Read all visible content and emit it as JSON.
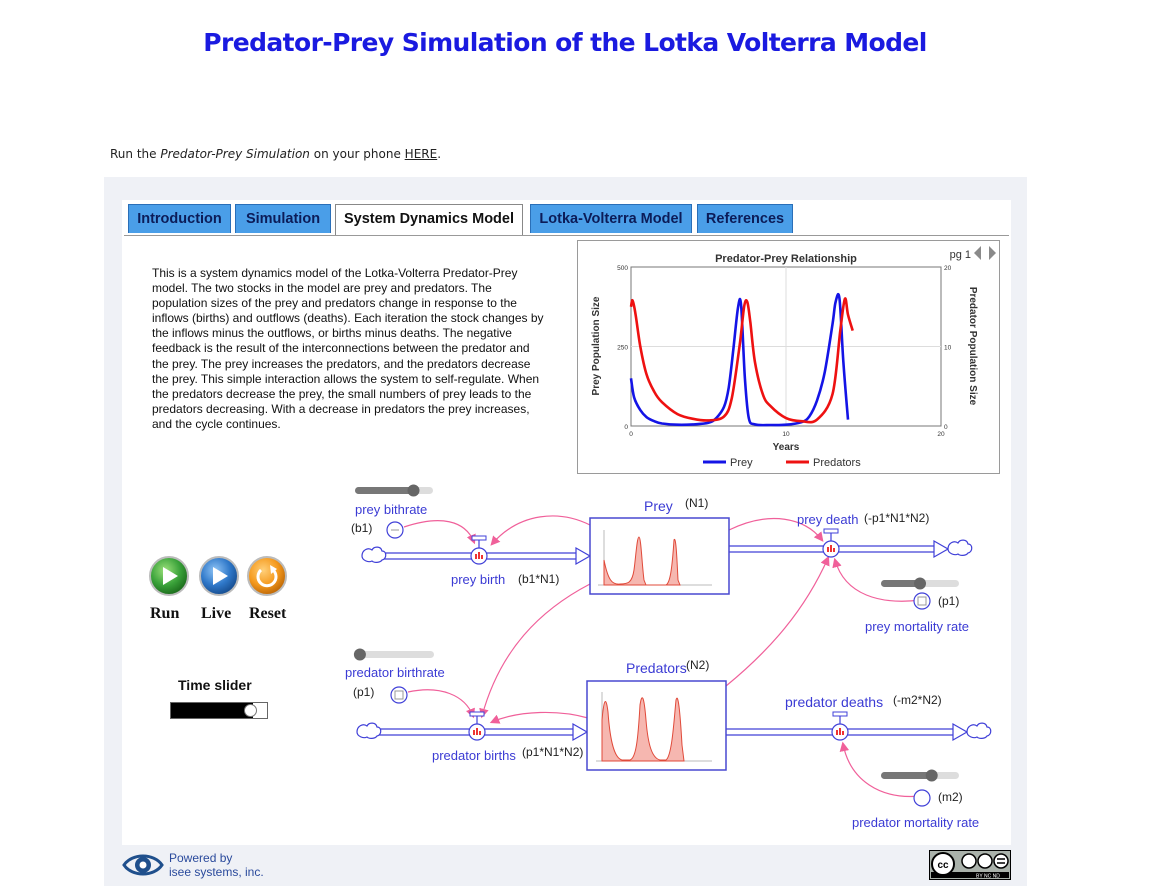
{
  "title": "Predator-Prey Simulation of the Lotka Volterra Model",
  "run_line": {
    "prefix": "Run the ",
    "italic": "Predator-Prey Simulation",
    "middle": " on your phone ",
    "link": "HERE",
    "suffix": "."
  },
  "tabs": [
    {
      "label": "Introduction",
      "active": false
    },
    {
      "label": "Simulation",
      "active": false
    },
    {
      "label": "System Dynamics Model",
      "active": true
    },
    {
      "label": "Lotka-Volterra Model",
      "active": false
    },
    {
      "label": "References",
      "active": false
    }
  ],
  "description": "This is a system dynamics model of the Lotka-Volterra Predator-Prey model. The two stocks in the model are prey and predators. The population sizes of the prey and predators change in response to the inflows (births) and outflows (deaths). Each iteration the stock changes by the inflows minus the outflows, or births minus deaths. The negative feedback is the result of the interconnections between the predator and the prey. The prey increases the predators, and the predators decrease the prey. This simple interaction allows the system to self-regulate. When the predators decrease the prey, the small numbers of prey leads to the predators decreasing. With a decrease in predators the prey increases, and the cycle continues.",
  "chart_data": {
    "type": "line",
    "title": "Predator-Prey Relationship",
    "page_label": "pg 1",
    "xlabel": "Years",
    "ylabel": "Prey Population Size",
    "y2label": "Predator Population Size",
    "xlim": [
      0,
      20
    ],
    "ylim": [
      0,
      500
    ],
    "y2lim": [
      0,
      20
    ],
    "x_ticks": [
      "0",
      "10",
      "20"
    ],
    "y_ticks": [
      "0",
      "250",
      "500"
    ],
    "y2_ticks": [
      "0",
      "10",
      "20"
    ],
    "grid": true,
    "legend": "bottom",
    "series": [
      {
        "name": "Prey",
        "axis": "left",
        "color": "#1414e6",
        "x": [
          0,
          0.2,
          0.6,
          1.0,
          1.5,
          2,
          3,
          4,
          5,
          5.5,
          6,
          6.3,
          6.6,
          6.9,
          7.1,
          7.35,
          7.6,
          8,
          9,
          10,
          11,
          11.5,
          12,
          12.5,
          13,
          13.2,
          13.45,
          13.7,
          14
        ],
        "values": [
          150,
          90,
          50,
          28,
          15,
          8,
          4,
          5,
          10,
          25,
          60,
          120,
          240,
          370,
          380,
          150,
          25,
          5,
          3,
          4,
          12,
          30,
          80,
          170,
          320,
          390,
          400,
          200,
          20
        ]
      },
      {
        "name": "Predators",
        "axis": "right",
        "color": "#ee1111",
        "x": [
          0,
          0.1,
          0.3,
          0.6,
          1.0,
          1.5,
          2,
          3,
          4,
          5,
          6,
          6.5,
          7.0,
          7.3,
          7.5,
          7.7,
          8,
          8.5,
          9,
          10,
          11,
          12,
          13,
          13.5,
          13.8,
          14.0,
          14.3
        ],
        "values": [
          15,
          15.8,
          14,
          10,
          6.5,
          4.3,
          3.0,
          1.5,
          0.9,
          0.7,
          1.2,
          3.5,
          10,
          15,
          15.6,
          13,
          8,
          4,
          2.5,
          1.0,
          0.6,
          0.8,
          4,
          12,
          16,
          14,
          12
        ]
      }
    ]
  },
  "model": {
    "prey_stock_label": "Prey",
    "prey_stock_eq": "(N1)",
    "predators_stock_label": "Predators",
    "predators_stock_eq": "(N2)",
    "prey_birthrate_label": "prey bithrate",
    "prey_birthrate_eq": "(b1)",
    "prey_birthrate_level": 0.75,
    "prey_birth_label": "prey birth",
    "prey_birth_eq": "(b1*N1)",
    "prey_death_label": "prey death",
    "prey_death_eq": "(-p1*N1*N2)",
    "prey_mortality_label": "prey mortality rate",
    "prey_mortality_eq": "(p1)",
    "prey_mortality_level": 0.5,
    "predator_birthrate_label": "predator birthrate",
    "predator_birthrate_eq": "(p1)",
    "predator_birthrate_level": 0.05,
    "predator_births_label": "predator births",
    "predator_births_eq": "(p1*N1*N2)",
    "predator_deaths_label": "predator deaths",
    "predator_deaths_eq": "(-m2*N2)",
    "predator_mortality_label": "predator mortality rate",
    "predator_mortality_eq": "(m2)",
    "predator_mortality_level": 0.65
  },
  "controls": {
    "run": "Run",
    "live": "Live",
    "reset": "Reset"
  },
  "time_slider": {
    "label": "Time slider",
    "level": 0.85
  },
  "footer": {
    "powered_by": "Powered by",
    "company": "isee systems, inc.",
    "license": "cc BY NC ND"
  },
  "colors": {
    "title": "#1a1ae0",
    "tab": "#4a9ee8",
    "label": "#3b3bd4",
    "link_arrow": "#f0609a",
    "prey": "#1414e6",
    "predators": "#ee1111"
  }
}
